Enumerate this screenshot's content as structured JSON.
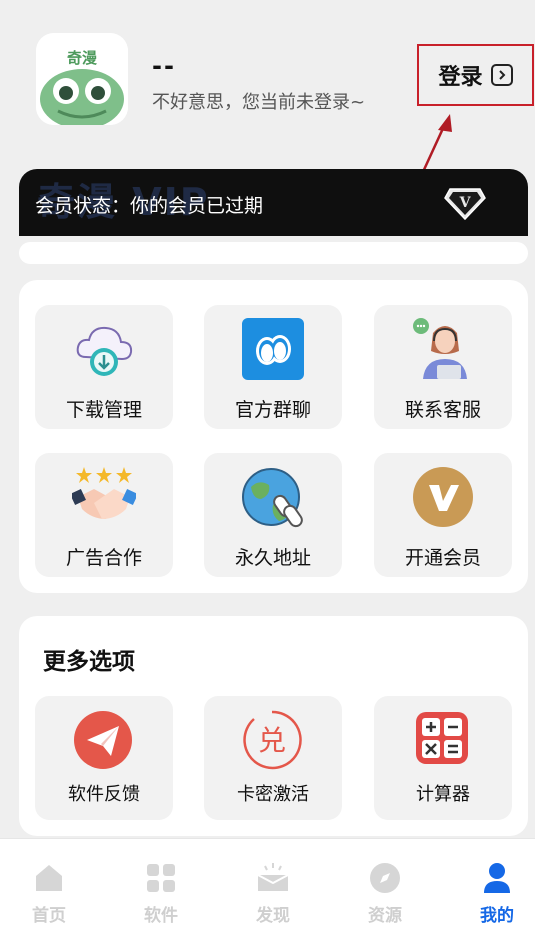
{
  "profile": {
    "logo_text": "奇漫",
    "username": "--",
    "subtitle": "不好意思，您当前未登录~",
    "login_label": "登录"
  },
  "vip": {
    "watermark": "奇漫 VIP",
    "status": "会员状态：你的会员已过期"
  },
  "grid": {
    "items": [
      {
        "label": "下载管理",
        "icon": "cloud-download-icon"
      },
      {
        "label": "官方群聊",
        "icon": "group-chat-icon"
      },
      {
        "label": "联系客服",
        "icon": "customer-service-icon"
      },
      {
        "label": "广告合作",
        "icon": "handshake-icon"
      },
      {
        "label": "永久地址",
        "icon": "globe-link-icon"
      },
      {
        "label": "开通会员",
        "icon": "vip-coin-icon"
      }
    ]
  },
  "more": {
    "title": "更多选项",
    "items": [
      {
        "label": "软件反馈",
        "icon": "paper-plane-icon"
      },
      {
        "label": "卡密激活",
        "icon": "redeem-icon"
      },
      {
        "label": "计算器",
        "icon": "calculator-icon"
      }
    ]
  },
  "nav": {
    "items": [
      {
        "label": "首页",
        "icon": "home-icon"
      },
      {
        "label": "软件",
        "icon": "apps-icon"
      },
      {
        "label": "发现",
        "icon": "discover-icon"
      },
      {
        "label": "资源",
        "icon": "compass-icon"
      },
      {
        "label": "我的",
        "icon": "user-icon"
      }
    ],
    "active_index": 4
  },
  "colors": {
    "accent": "#1568e6",
    "annotation": "#c8202a",
    "vip_bg": "#0f0f0f"
  }
}
